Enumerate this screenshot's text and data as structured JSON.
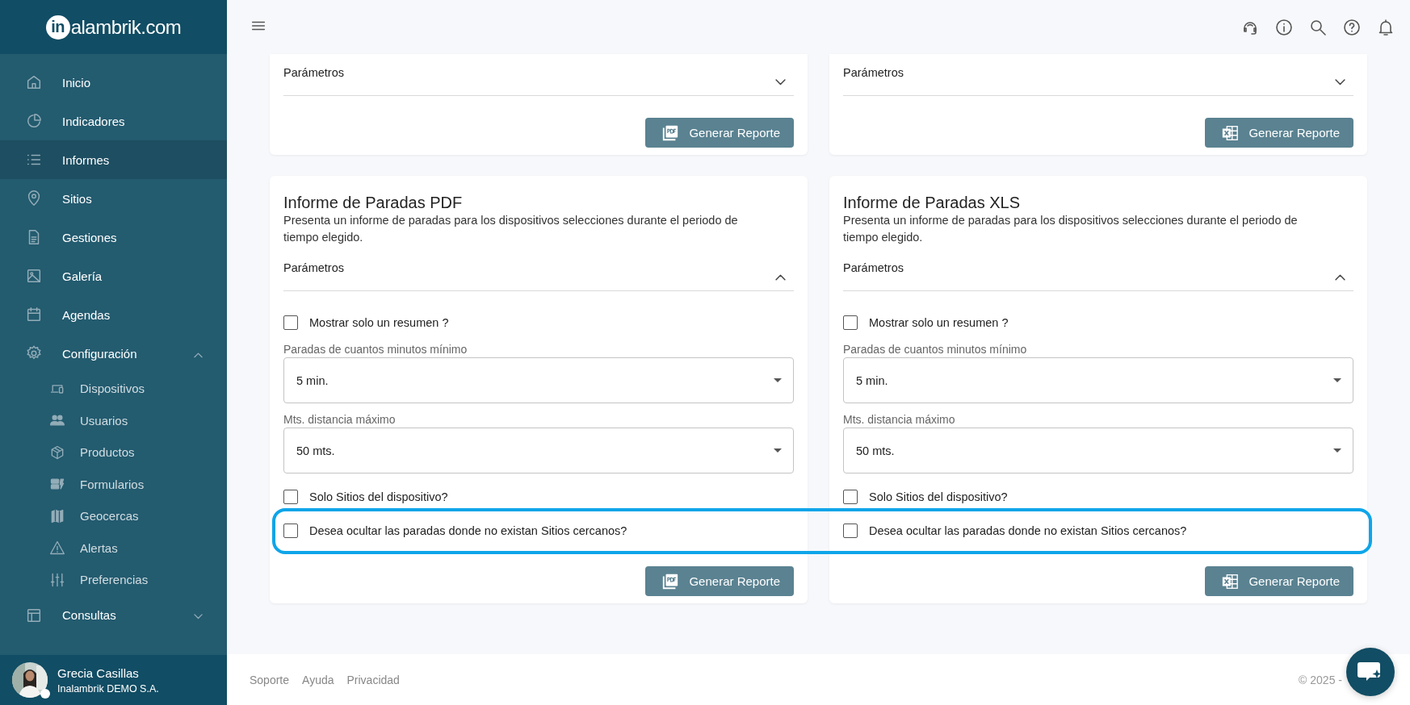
{
  "logo": {
    "mark": "in",
    "text": "alambrik.com"
  },
  "sidebar": {
    "items": [
      {
        "label": "Inicio",
        "selected": false
      },
      {
        "label": "Indicadores",
        "selected": false
      },
      {
        "label": "Informes",
        "selected": true
      },
      {
        "label": "Sitios",
        "selected": false
      },
      {
        "label": "Gestiones",
        "selected": false
      },
      {
        "label": "Galería",
        "selected": false
      },
      {
        "label": "Agendas",
        "selected": false
      },
      {
        "label": "Configuración",
        "selected": false,
        "expanded": true,
        "children": [
          {
            "label": "Dispositivos",
            "selected": false
          },
          {
            "label": "Usuarios",
            "selected": false
          },
          {
            "label": "Productos",
            "selected": false
          },
          {
            "label": "Formularios",
            "selected": false
          },
          {
            "label": "Geocercas",
            "selected": false
          },
          {
            "label": "Alertas",
            "selected": false
          },
          {
            "label": "Preferencias",
            "selected": false
          }
        ]
      },
      {
        "label": "Consultas",
        "selected": false,
        "expanded": false
      }
    ]
  },
  "user": {
    "name": "Grecia Casillas",
    "company": "Inalambrik DEMO S.A."
  },
  "top_cards": [
    {
      "parameters_label": "Parámetros",
      "expanded": false,
      "button": {
        "label": "Generar Reporte",
        "kind": "pdf"
      }
    },
    {
      "parameters_label": "Parámetros",
      "expanded": false,
      "button": {
        "label": "Generar Reporte",
        "kind": "xls"
      }
    }
  ],
  "cards": [
    {
      "title": "Informe de Paradas PDF",
      "description": "Presenta un informe de paradas para los dispositivos selecciones durante el periodo de tiempo elegido.",
      "parameters_label": "Parámetros",
      "expanded": true,
      "fields": [
        {
          "kind": "checkbox",
          "label": "Mostrar solo un resumen ?",
          "checked": false
        },
        {
          "kind": "select",
          "label": "Paradas de cuantos minutos mínimo",
          "value": "5 min."
        },
        {
          "kind": "select",
          "label": "Mts. distancia máximo",
          "value": "50 mts."
        },
        {
          "kind": "checkbox",
          "label": "Solo Sitios del dispositivo?",
          "checked": false
        },
        {
          "kind": "checkbox",
          "label": "Desea ocultar las paradas donde no existan Sitios cercanos?",
          "checked": false
        }
      ],
      "button": {
        "label": "Generar Reporte",
        "kind": "pdf"
      }
    },
    {
      "title": "Informe de Paradas XLS",
      "description": "Presenta un informe de paradas para los dispositivos selecciones durante el periodo de tiempo elegido.",
      "parameters_label": "Parámetros",
      "expanded": true,
      "fields": [
        {
          "kind": "checkbox",
          "label": "Mostrar solo un resumen ?",
          "checked": false
        },
        {
          "kind": "select",
          "label": "Paradas de cuantos minutos mínimo",
          "value": "5 min."
        },
        {
          "kind": "select",
          "label": "Mts. distancia máximo",
          "value": "50 mts."
        },
        {
          "kind": "checkbox",
          "label": "Solo Sitios del dispositivo?",
          "checked": false
        },
        {
          "kind": "checkbox",
          "label": "Desea ocultar las paradas donde no existan Sitios cercanos?",
          "checked": false
        }
      ],
      "button": {
        "label": "Generar Reporte",
        "kind": "xls"
      }
    }
  ],
  "highlight_frame": true,
  "footer": {
    "links": [
      "Soporte",
      "Ayuda",
      "Privacidad"
    ],
    "copyright": "© 2025 -"
  }
}
